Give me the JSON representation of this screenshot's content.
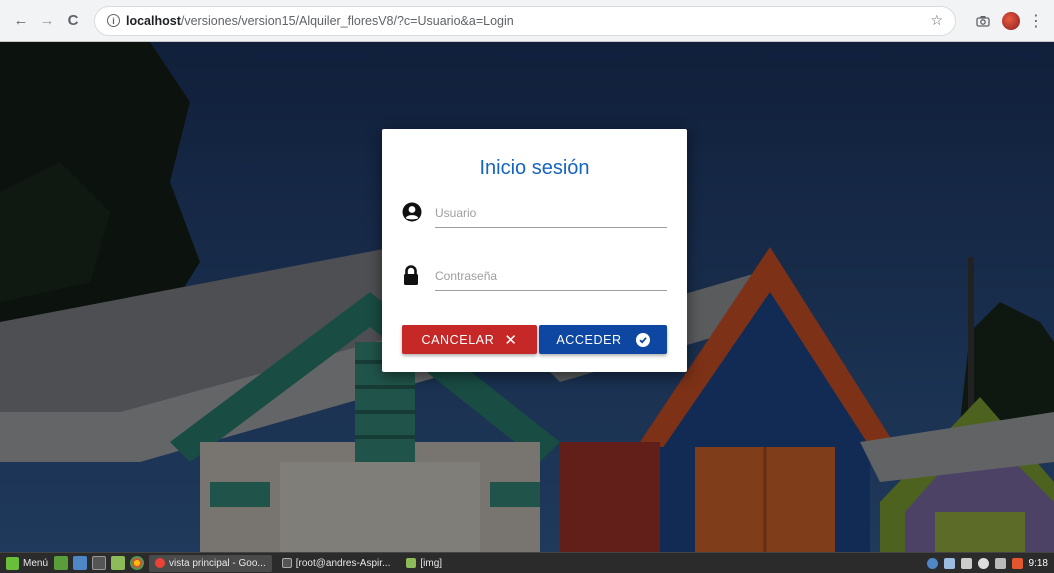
{
  "browser": {
    "url_host": "localhost",
    "url_path": "/versiones/version15/Alquiler_floresV8/?c=Usuario&a=Login"
  },
  "login": {
    "title": "Inicio sesión",
    "username_placeholder": "Usuario",
    "password_placeholder": "Contraseña",
    "cancel_label": "CANCELAR",
    "submit_label": "ACCEDER",
    "colors": {
      "title": "#1565c0",
      "cancel_bg": "#c62828",
      "submit_bg": "#0d47a1"
    }
  },
  "taskbar": {
    "menu_label": "Menú",
    "tasks": [
      {
        "label": "vista principal - Goo...",
        "active": true
      },
      {
        "label": "[root@andres-Aspir...",
        "active": false
      },
      {
        "label": "[img]",
        "active": false
      }
    ],
    "clock": "9:18"
  },
  "icons": {
    "back": "arrow-left-icon",
    "forward": "arrow-right-icon",
    "reload": "reload-icon",
    "info": "info-icon",
    "bookmark": "star-icon",
    "screenshot": "camera-icon",
    "profile": "profile-avatar-icon",
    "menu": "more-vertical-icon",
    "user": "user-circle-icon",
    "lock": "lock-icon",
    "cancel": "close-icon",
    "submit": "check-circle-icon"
  }
}
